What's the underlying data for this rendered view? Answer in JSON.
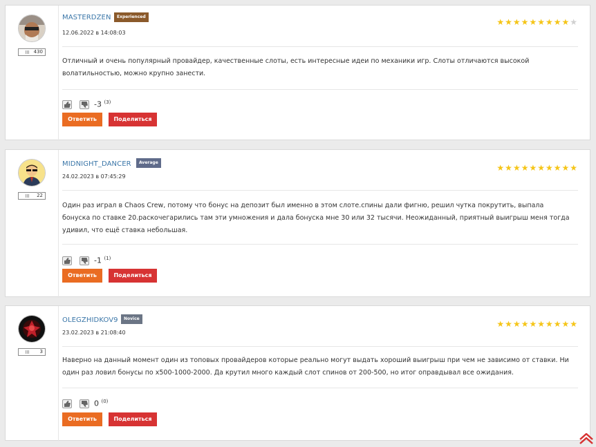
{
  "comments": [
    {
      "username": "MASTERDZEN",
      "rank": "Experienced",
      "rank_color": "#8b5a2b",
      "date": "12.06.2022 в 14:08:03",
      "reputation": "430",
      "rating": 9,
      "rating_max": 10,
      "text": "Отличный и очень популярный провайдер, качественные слоты, есть интересные идеи по механики игр. Слоты отличаются высокой волатильностью, можно крупно занести.",
      "score": "-3",
      "votes": "(3)",
      "reply_label": "Ответить",
      "share_label": "Поделиться"
    },
    {
      "username": "MIDNIGHT_DANCER",
      "rank": "Average",
      "rank_color": "#5f6b8a",
      "date": "24.02.2023 в 07:45:29",
      "reputation": "22",
      "rating": 10,
      "rating_max": 10,
      "text": "Один раз играл в Chaos Crew, потому что бонус на депозит был именно в этом слоте.спины дали фигню, решил чутка покрутить, выпала бонуска по ставке 20.раскочегарились там эти умножения и дала бонуска мне 30 или 32 тысячи. Неожиданный, приятный выигрыш меня тогда удивил, что ещё ставка небольшая.",
      "score": "-1",
      "votes": "(1)",
      "reply_label": "Ответить",
      "share_label": "Поделиться"
    },
    {
      "username": "OLEGZHIDKOV9",
      "rank": "Novice",
      "rank_color": "#6b7585",
      "date": "23.02.2023 в 21:08:40",
      "reputation": "3",
      "rating": 10,
      "rating_max": 10,
      "text": "Наверно на данный момент один из топовых провайдеров которые реально могут выдать хороший выигрыш при чем не зависимо от ставки. Ни один раз ловил бонусы по х500-1000-2000. Да крутил много каждый слот спинов от 200-500, но итог оправдывал все ожидания.",
      "score": "0",
      "votes": "(0)",
      "reply_label": "Ответить",
      "share_label": "Поделиться"
    }
  ],
  "icons": {
    "like": "thumbs-up-icon",
    "dislike": "thumbs-down-icon",
    "scroll_top": "double-chevron-up-icon"
  },
  "colors": {
    "username": "#3a76a8",
    "star": "#f5c518",
    "reply_button": "#ea6c22",
    "share_button": "#d73333"
  }
}
